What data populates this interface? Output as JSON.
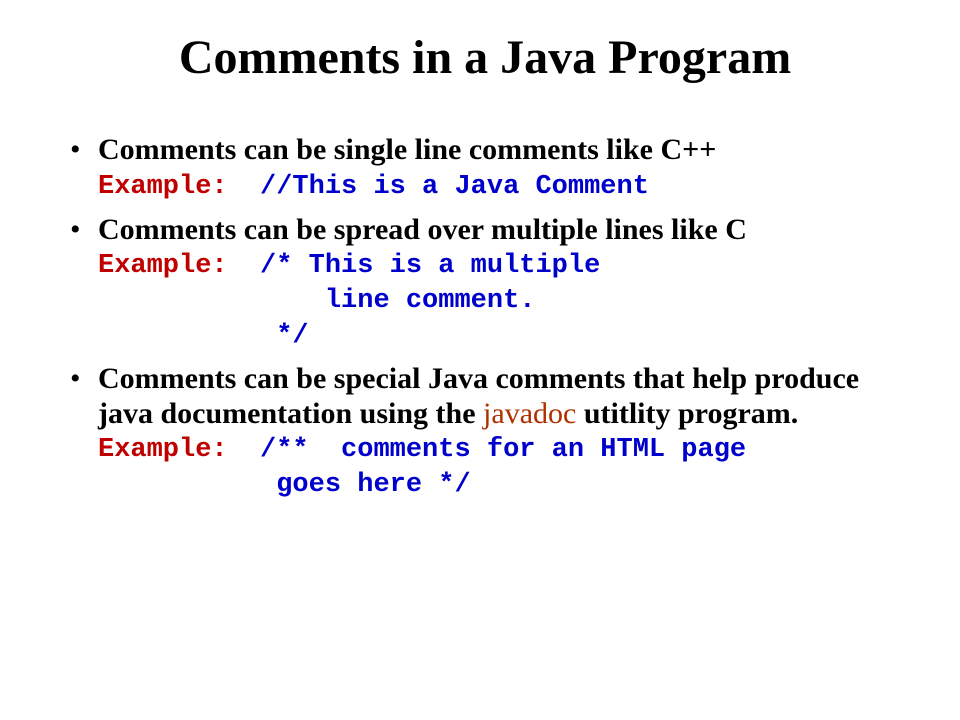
{
  "title": "Comments in a Java Program",
  "bullets": [
    {
      "text": "Comments can be single line comments like C++",
      "example_label": "Example:",
      "code": "  //This is a Java Comment"
    },
    {
      "text": "Comments can be spread over multiple lines like C",
      "example_label": "Example:",
      "code": "  /* This is a multiple\n              line comment.\n           */"
    },
    {
      "text_pre": "Comments can be special Java comments that help produce java documentation using the ",
      "javadoc": "javadoc",
      "text_post": " utitlity program.",
      "example_label": "Example:",
      "code": "  /**  comments for an HTML page\n           goes here */"
    }
  ]
}
